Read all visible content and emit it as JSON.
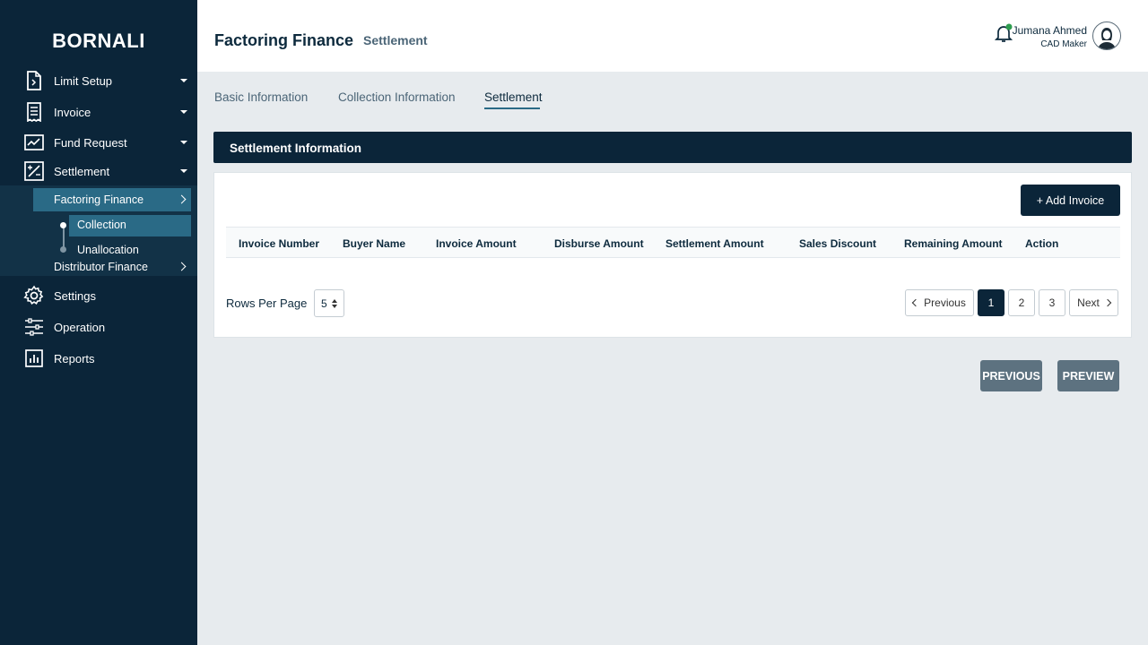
{
  "sidebar": {
    "brand": "BORNALI",
    "items": [
      {
        "label": "Limit Setup",
        "icon": "document-icon"
      },
      {
        "label": "Invoice",
        "icon": "receipt-icon"
      },
      {
        "label": "Fund Request",
        "icon": "chart-line-icon"
      },
      {
        "label": "Settlement",
        "icon": "percent-icon"
      },
      {
        "label": "Settings",
        "icon": "gear-icon"
      },
      {
        "label": "Operation",
        "icon": "sliders-icon"
      },
      {
        "label": "Reports",
        "icon": "bar-chart-icon"
      }
    ],
    "settlement_sub": {
      "factoring_finance": "Factoring Finance",
      "collection": "Collection",
      "unallocation": "Unallocation",
      "distributor_finance": "Distributor Finance"
    }
  },
  "header": {
    "title": "Factoring Finance",
    "subtitle": "Settlement",
    "user_name": "Jumana Ahmed",
    "user_role": "CAD Maker"
  },
  "tabs": [
    {
      "label": "Basic Information"
    },
    {
      "label": "Collection Information"
    },
    {
      "label": "Settlement",
      "active": true
    }
  ],
  "section": {
    "title": "Settlement Information",
    "add_button": "+ Add Invoice",
    "columns": [
      "Invoice Number",
      "Buyer Name",
      "Invoice Amount",
      "Disburse Amount",
      "Settlement Amount",
      "Sales Discount",
      "Remaining Amount",
      "Action"
    ],
    "rows": []
  },
  "pagination": {
    "rows_per_page_label": "Rows Per Page",
    "rows_per_page": "5",
    "previous": "Previous",
    "pages": [
      "1",
      "2",
      "3"
    ],
    "current_page": "1",
    "next": "Next"
  },
  "footer": {
    "previous": "PREVIOUS",
    "preview": "PREVIEW"
  },
  "colors": {
    "sidebar_bg": "#0b2539",
    "accent": "#2a6a86",
    "online": "#2e9d4f"
  }
}
